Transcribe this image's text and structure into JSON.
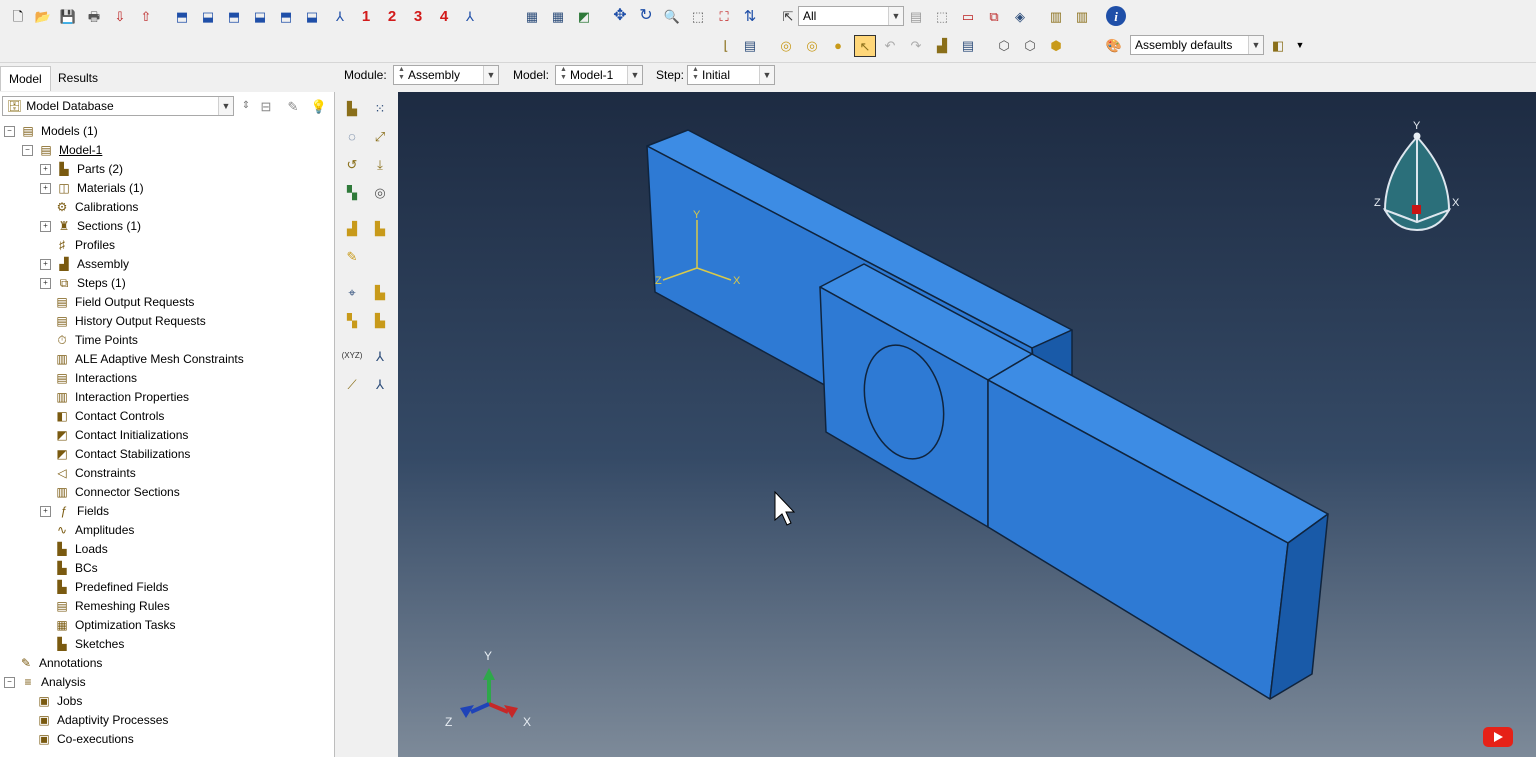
{
  "toolbar": {
    "view_buttons": [
      "1",
      "2",
      "3",
      "4"
    ],
    "selection_filter": "All",
    "render_style": "Assembly defaults"
  },
  "context_bar": {
    "module_label": "Module:",
    "module_value": "Assembly",
    "model_label": "Model:",
    "model_value": "Model-1",
    "step_label": "Step:",
    "step_value": "Initial"
  },
  "tabs": [
    "Model",
    "Results"
  ],
  "tree_selector": "Model Database",
  "tree": [
    {
      "label": "Models (1)",
      "indent": 0,
      "exp": "-"
    },
    {
      "label": "Model-1",
      "indent": 1,
      "exp": "-",
      "underline": true
    },
    {
      "label": "Parts (2)",
      "indent": 2,
      "exp": "+"
    },
    {
      "label": "Materials (1)",
      "indent": 2,
      "exp": "+"
    },
    {
      "label": "Calibrations",
      "indent": 2,
      "exp": ""
    },
    {
      "label": "Sections (1)",
      "indent": 2,
      "exp": "+"
    },
    {
      "label": "Profiles",
      "indent": 2,
      "exp": ""
    },
    {
      "label": "Assembly",
      "indent": 2,
      "exp": "+"
    },
    {
      "label": "Steps (1)",
      "indent": 2,
      "exp": "+"
    },
    {
      "label": "Field Output Requests",
      "indent": 2,
      "exp": ""
    },
    {
      "label": "History Output Requests",
      "indent": 2,
      "exp": ""
    },
    {
      "label": "Time Points",
      "indent": 2,
      "exp": ""
    },
    {
      "label": "ALE Adaptive Mesh Constraints",
      "indent": 2,
      "exp": ""
    },
    {
      "label": "Interactions",
      "indent": 2,
      "exp": ""
    },
    {
      "label": "Interaction Properties",
      "indent": 2,
      "exp": ""
    },
    {
      "label": "Contact Controls",
      "indent": 2,
      "exp": ""
    },
    {
      "label": "Contact Initializations",
      "indent": 2,
      "exp": ""
    },
    {
      "label": "Contact Stabilizations",
      "indent": 2,
      "exp": ""
    },
    {
      "label": "Constraints",
      "indent": 2,
      "exp": ""
    },
    {
      "label": "Connector Sections",
      "indent": 2,
      "exp": ""
    },
    {
      "label": "Fields",
      "indent": 2,
      "exp": "+"
    },
    {
      "label": "Amplitudes",
      "indent": 2,
      "exp": ""
    },
    {
      "label": "Loads",
      "indent": 2,
      "exp": ""
    },
    {
      "label": "BCs",
      "indent": 2,
      "exp": ""
    },
    {
      "label": "Predefined Fields",
      "indent": 2,
      "exp": ""
    },
    {
      "label": "Remeshing Rules",
      "indent": 2,
      "exp": ""
    },
    {
      "label": "Optimization Tasks",
      "indent": 2,
      "exp": ""
    },
    {
      "label": "Sketches",
      "indent": 2,
      "exp": ""
    },
    {
      "label": "Annotations",
      "indent": 0,
      "exp": ""
    },
    {
      "label": "Analysis",
      "indent": 0,
      "exp": "-"
    },
    {
      "label": "Jobs",
      "indent": 1,
      "exp": ""
    },
    {
      "label": "Adaptivity Processes",
      "indent": 1,
      "exp": ""
    },
    {
      "label": "Co-executions",
      "indent": 1,
      "exp": ""
    }
  ],
  "viewport": {
    "triad_x": "X",
    "triad_y": "Y",
    "triad_z": "Z",
    "csys_x": "X",
    "csys_y": "Y",
    "csys_z": "Z",
    "cube_x": "X",
    "cube_y": "Y",
    "cube_z": "Z",
    "part_color": "#2f7fd6",
    "background_top": "#1d2b42",
    "background_bottom": "#7d8a99"
  }
}
